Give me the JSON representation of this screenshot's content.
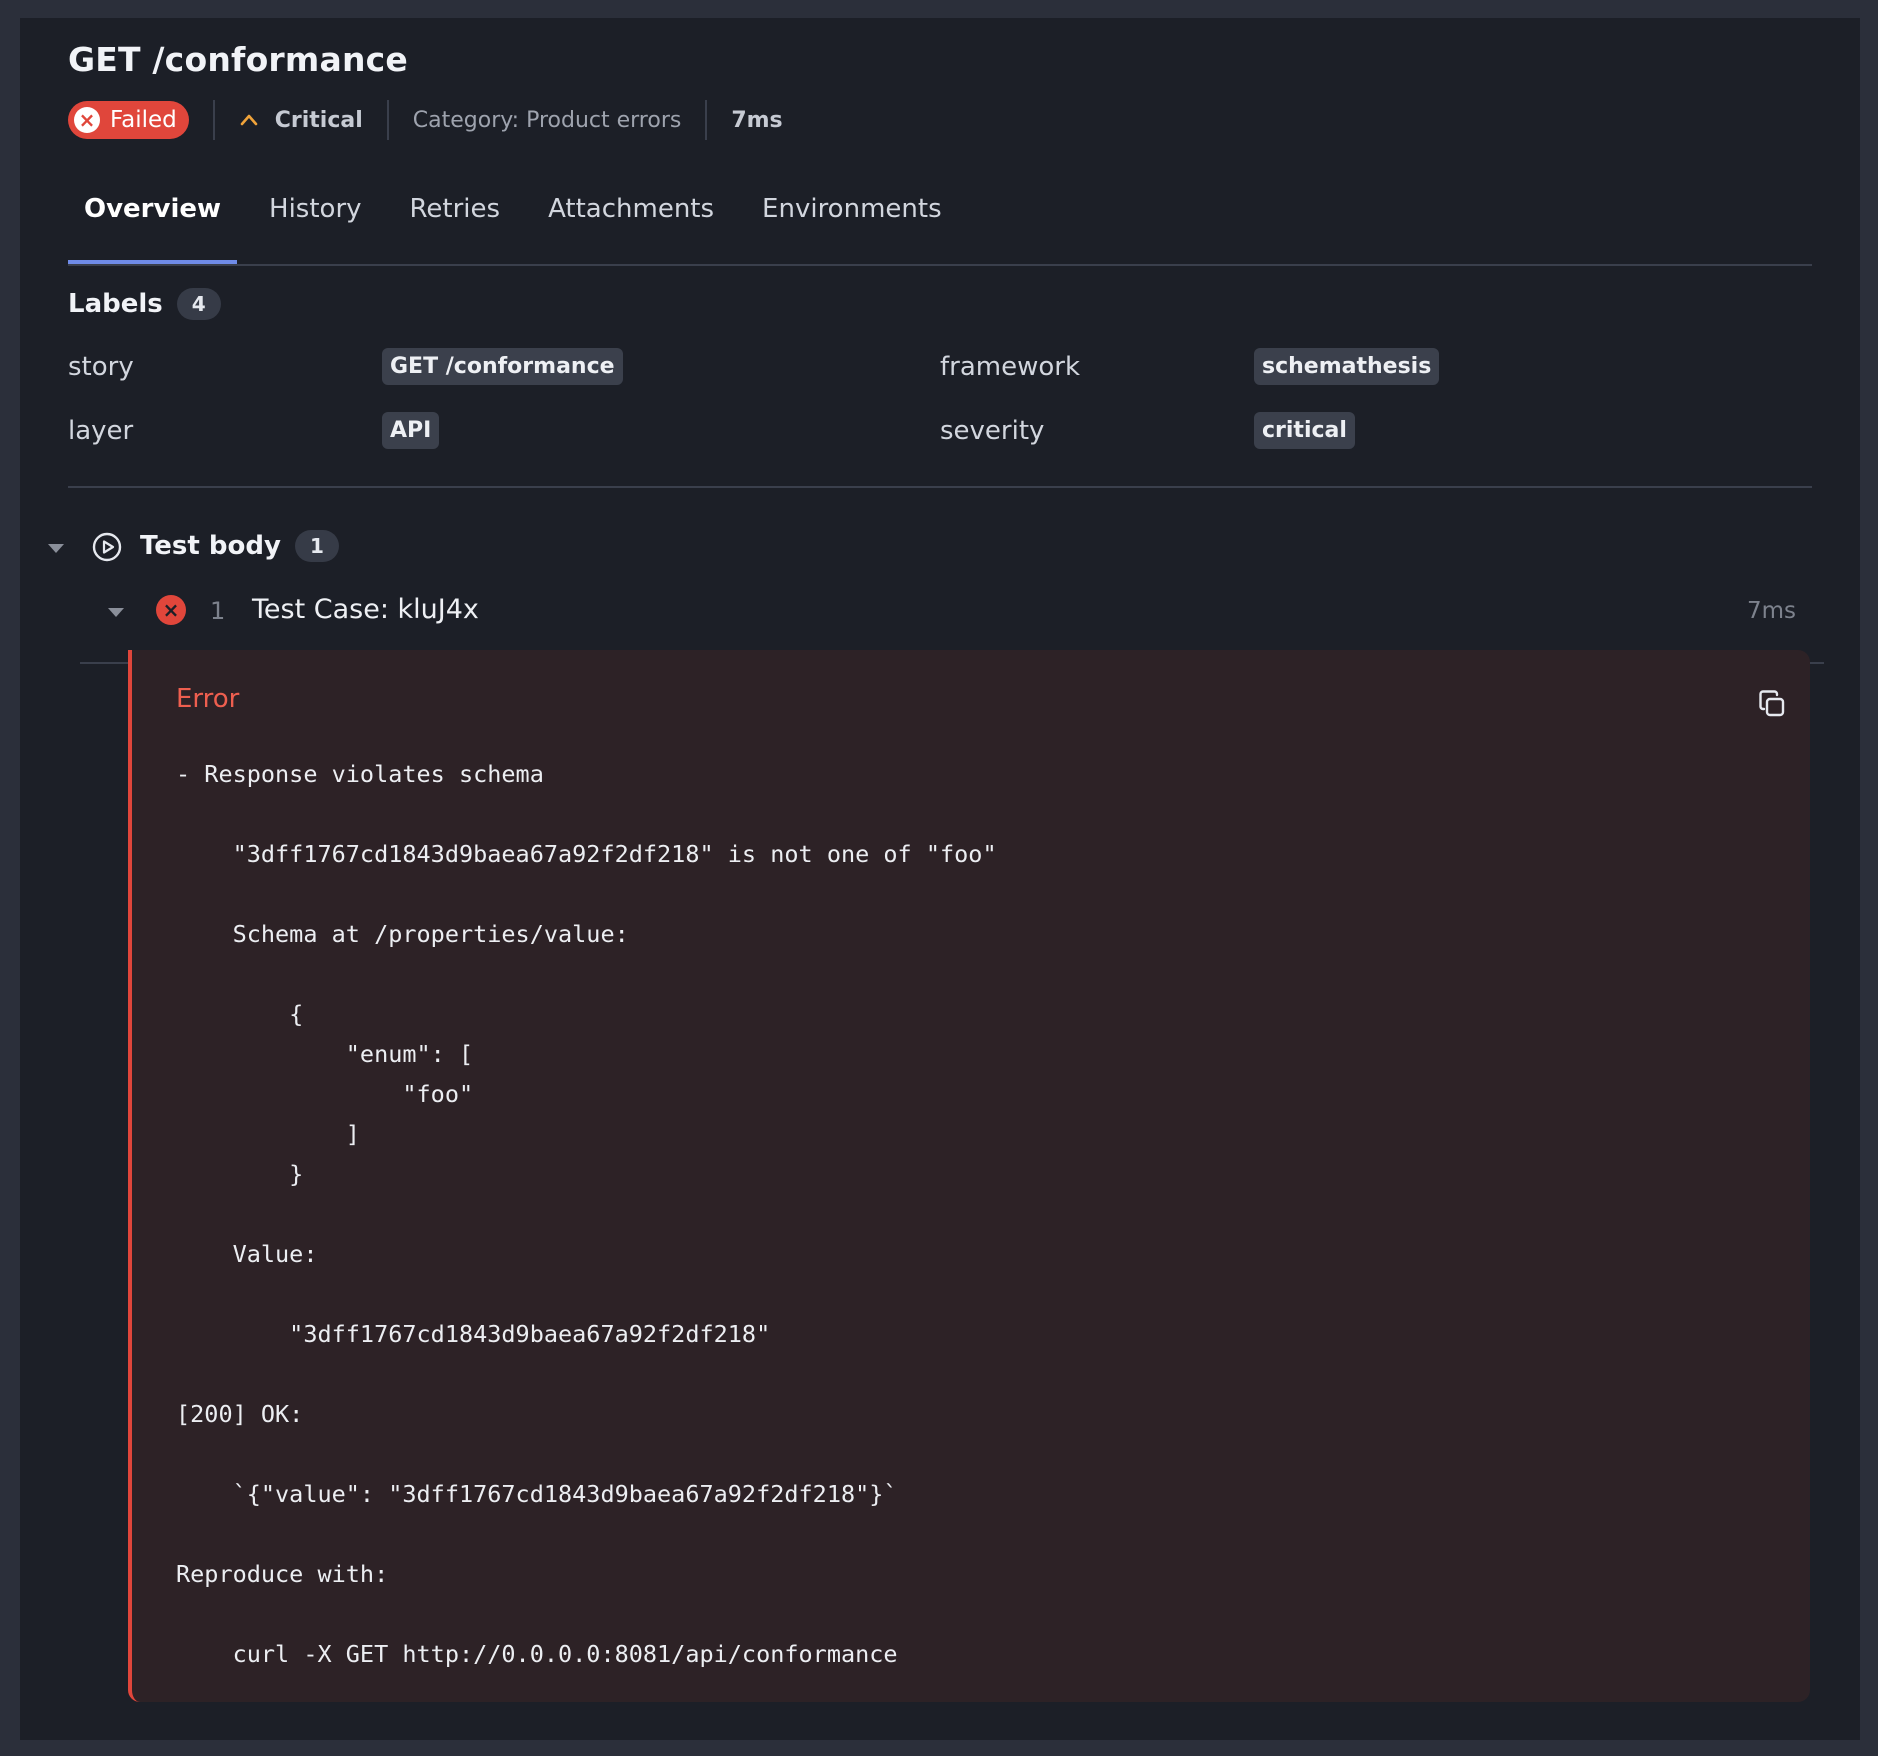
{
  "header": {
    "title": "GET /conformance",
    "status": "Failed",
    "severity": "Critical",
    "category": "Category: Product errors",
    "duration": "7ms"
  },
  "tabs": [
    "Overview",
    "History",
    "Retries",
    "Attachments",
    "Environments"
  ],
  "active_tab": "Overview",
  "labels": {
    "heading": "Labels",
    "count": "4",
    "items": [
      {
        "key": "story",
        "value": "GET /conformance"
      },
      {
        "key": "framework",
        "value": "schemathesis"
      },
      {
        "key": "layer",
        "value": "API"
      },
      {
        "key": "severity",
        "value": "critical"
      }
    ]
  },
  "test_body": {
    "title": "Test body",
    "count": "1",
    "step": {
      "index": "1",
      "name": "Test Case: kluJ4x",
      "duration": "7ms"
    }
  },
  "error": {
    "title": "Error",
    "message": "- Response violates schema\n\n    \"3dff1767cd1843d9baea67a92f2df218\" is not one of \"foo\"\n\n    Schema at /properties/value:\n\n        {\n            \"enum\": [\n                \"foo\"\n            ]\n        }\n\n    Value:\n\n        \"3dff1767cd1843d9baea67a92f2df218\"\n\n[200] OK:\n\n    `{\"value\": \"3dff1767cd1843d9baea67a92f2df218\"}`\n\nReproduce with:\n\n    curl -X GET http://0.0.0.0:8081/api/conformance"
  },
  "icons": {
    "status": "close-circle-icon",
    "severity": "chevron-up-icon",
    "body": "play-circle-icon",
    "copy": "copy-icon",
    "collapse": "caret-down-icon"
  },
  "colors": {
    "failed": "#e0463b",
    "critical": "#f0a33a",
    "accent": "#6f8be8",
    "background": "#1c1f27",
    "error_background": "#2d2226"
  }
}
